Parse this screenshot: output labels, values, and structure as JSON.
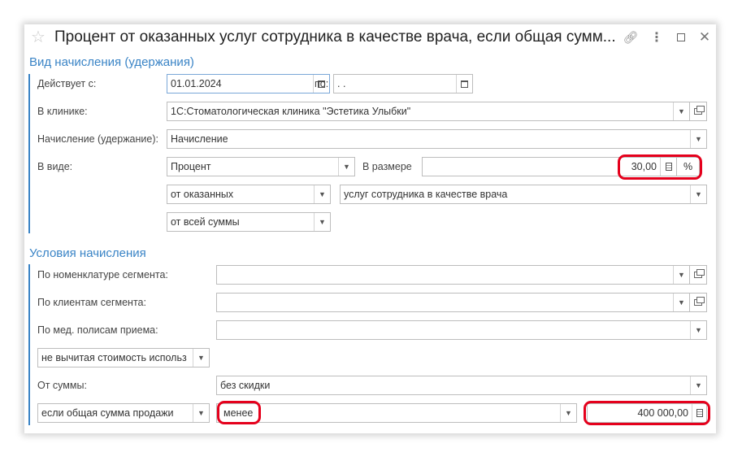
{
  "window": {
    "title": "Процент от оказанных услуг сотрудника в качестве врача, если общая сумм..."
  },
  "accrual_section": {
    "title": "Вид начисления (удержания)",
    "valid_from_label": "Действует с:",
    "valid_from_value": "01.01.2024",
    "valid_to_label": "по:",
    "valid_to_value": " .  .",
    "clinic_label": "В клинике:",
    "clinic_value": "1С:Стоматологическая клиника \"Эстетика Улыбки\"",
    "accrual_label": "Начисление (удержание):",
    "accrual_value": "Начисление",
    "kind_label": "В виде:",
    "kind_value": "Процент",
    "amount_label": "В размере",
    "amount_value": "30,00",
    "percent_label": "%",
    "from_value": "от оказанных",
    "services_value": "услуг сотрудника в качестве врача",
    "sum_value": "от всей суммы"
  },
  "conditions_section": {
    "title": "Условия начисления",
    "nomenclature_label": "По номенклатуре сегмента:",
    "nomenclature_value": "",
    "clients_label": "По клиентам сегмента:",
    "clients_value": "",
    "policies_label": "По мед. полисам приема:",
    "policies_value": "",
    "deduct_value": "не вычитая стоимость использ",
    "from_sum_label": "От суммы:",
    "from_sum_value": "без скидки",
    "total_condition_value": "если общая сумма продажи",
    "compare_value": "менее",
    "threshold_value": "400 000,00"
  },
  "colors": {
    "accent": "#3a84c6",
    "highlight": "#e5001c"
  }
}
